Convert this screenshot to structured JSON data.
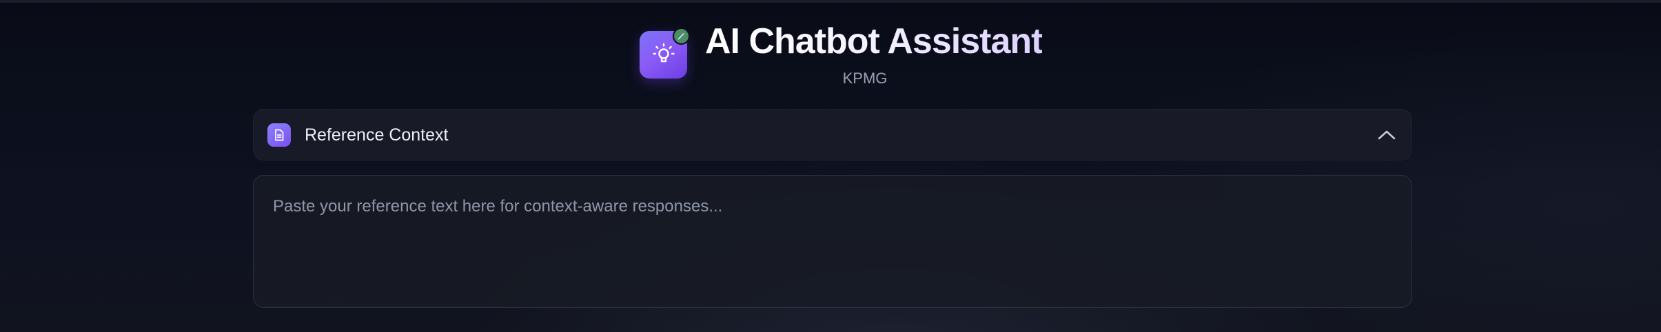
{
  "header": {
    "app_icon": "lightbulb-icon",
    "status_indicator": "edit-pencil-icon",
    "title": "AI Chatbot Assistant",
    "subtitle": "KPMG"
  },
  "reference_context": {
    "icon": "document-icon",
    "label": "Reference Context",
    "toggle_icon": "chevron-up-icon",
    "expanded": true,
    "textarea": {
      "value": "",
      "placeholder": "Paste your reference text here for context-aware responses..."
    }
  },
  "colors": {
    "background": "#0b0e19",
    "panel": "#181b27",
    "accent_purple": "#8b5cf6",
    "status_green": "#4d8c66",
    "placeholder_text": "#8f96a8",
    "subtitle_text": "#9aa1b4"
  }
}
